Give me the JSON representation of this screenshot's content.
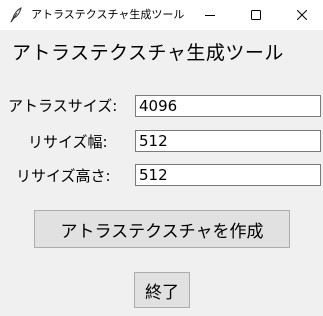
{
  "window": {
    "title": "アトラステクスチャ生成ツール",
    "controls": {
      "minimize_icon": "minimize-icon",
      "maximize_icon": "maximize-icon",
      "close_icon": "close-icon"
    }
  },
  "heading": "アトラステクスチャ生成ツール",
  "form": {
    "atlas_size": {
      "label": "アトラスサイズ:",
      "value": "4096"
    },
    "resize_width": {
      "label": "リサイズ幅:",
      "value": "512"
    },
    "resize_height": {
      "label": "リサイズ高さ:",
      "value": "512"
    }
  },
  "buttons": {
    "create_label": "アトラステクスチャを作成",
    "quit_label": "終了"
  },
  "colors": {
    "background": "#f0f0f0",
    "titlebar": "#ffffff",
    "button_face": "#e1e1e1",
    "button_border": "#adadad",
    "input_border": "#7a7a7a"
  }
}
